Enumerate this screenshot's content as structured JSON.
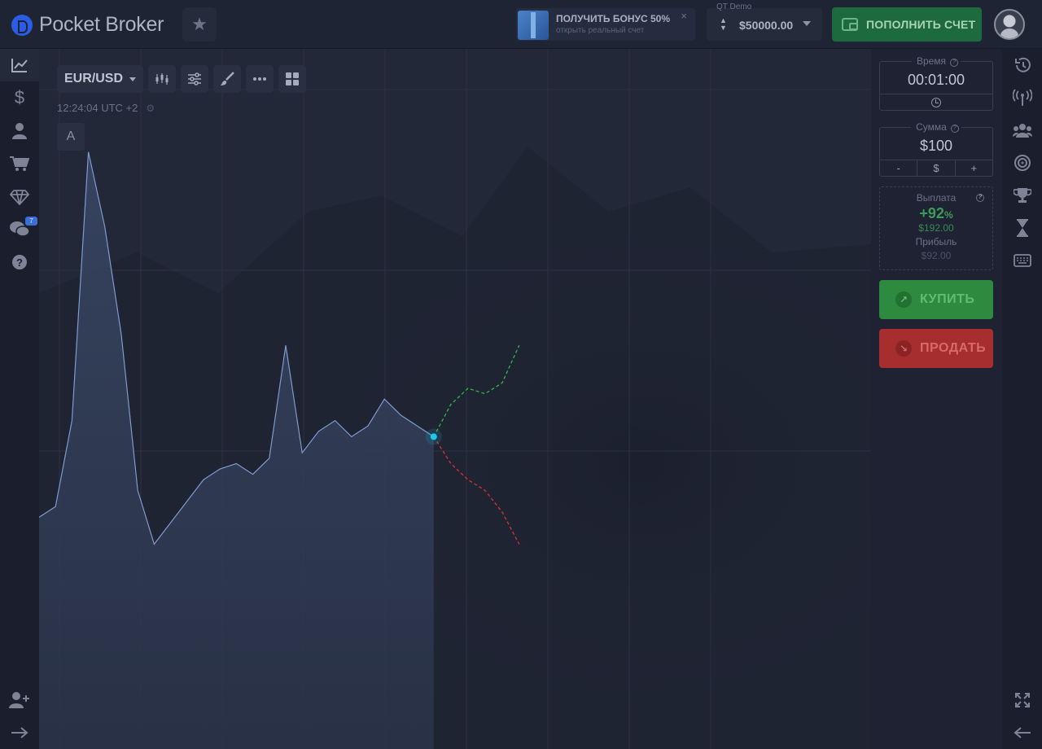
{
  "header": {
    "logo_text": "Pocket Broker",
    "bonus": {
      "title": "ПОЛУЧИТЬ БОНУС 50%",
      "subtitle": "открыть реальный счет",
      "close": "×"
    },
    "account": {
      "label": "QT Demo",
      "balance": "$50000.00"
    },
    "deposit_label": "ПОПОЛНИТЬ СЧЕТ"
  },
  "chart": {
    "pair": "EUR/USD",
    "time": "12:24:04 UTC +2",
    "auto_label": "A"
  },
  "notifications": {
    "chat_count": "7"
  },
  "panel": {
    "time_label": "Время",
    "time_value": "00:01:00",
    "amount_label": "Сумма",
    "amount_value": "$100",
    "amount_minus": "-",
    "amount_currency": "$",
    "amount_plus": "+",
    "payout_label": "Выплата",
    "payout_percent": "+92",
    "payout_percent_sign": "%",
    "payout_value": "$192.00",
    "profit_label": "Прибыль",
    "profit_value": "$92.00",
    "buy_label": "КУПИТЬ",
    "sell_label": "ПРОДАТЬ"
  },
  "colors": {
    "buy": "#2e8a3e",
    "sell": "#a62e2e",
    "deposit": "#1d6a3e",
    "accent": "#2b5ce6",
    "price_point": "#1ec8e8"
  },
  "chart_data": {
    "type": "area",
    "title": "",
    "xlabel": "",
    "ylabel": "",
    "x": [
      0,
      1,
      2,
      3,
      4,
      5,
      6,
      7,
      8,
      9,
      10,
      11,
      12,
      13,
      14,
      15,
      16,
      17,
      18,
      19,
      20,
      21,
      22,
      23,
      24
    ],
    "y": [
      0.31,
      0.33,
      0.49,
      0.99,
      0.85,
      0.65,
      0.36,
      0.26,
      0.3,
      0.34,
      0.38,
      0.4,
      0.41,
      0.39,
      0.42,
      0.63,
      0.43,
      0.47,
      0.49,
      0.46,
      0.48,
      0.53,
      0.5,
      0.48,
      0.46
    ],
    "forecast_up": [
      0.46,
      0.52,
      0.55,
      0.54,
      0.56,
      0.63
    ],
    "forecast_down": [
      0.46,
      0.41,
      0.38,
      0.36,
      0.32,
      0.26
    ],
    "ylim": [
      0,
      1
    ],
    "grid": true
  }
}
